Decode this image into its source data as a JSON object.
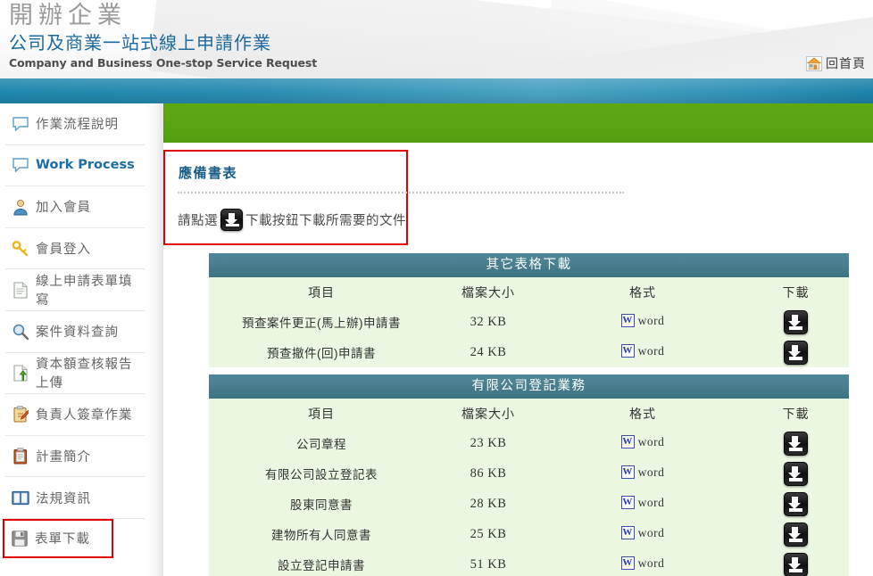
{
  "header": {
    "title_zh_large": "開辦企業",
    "title_zh_sub": "公司及商業一站式線上申請作業",
    "title_en": "Company and Business One-stop Service Request",
    "home_link_label": "回首頁",
    "home_icon": "house-icon"
  },
  "sidebar": {
    "items": [
      {
        "label": "作業流程說明",
        "icon": "speech-bubble-icon",
        "english": false,
        "selected": false
      },
      {
        "label": "Work Process",
        "icon": "speech-bubble-icon",
        "english": true,
        "selected": false
      },
      {
        "label": "加入會員",
        "icon": "user-add-icon",
        "english": false,
        "selected": false
      },
      {
        "label": "會員登入",
        "icon": "key-icon",
        "english": false,
        "selected": false
      },
      {
        "label": "線上申請表單填寫",
        "icon": "document-icon",
        "english": false,
        "selected": false
      },
      {
        "label": "案件資料查詢",
        "icon": "magnifier-icon",
        "english": false,
        "selected": false
      },
      {
        "label": "資本額查核報告上傳",
        "icon": "upload-document-icon",
        "english": false,
        "selected": false
      },
      {
        "label": "負責人簽章作業",
        "icon": "clipboard-pencil-icon",
        "english": false,
        "selected": false
      },
      {
        "label": "計畫簡介",
        "icon": "clipboard-icon",
        "english": false,
        "selected": false
      },
      {
        "label": "法規資訊",
        "icon": "book-icon",
        "english": false,
        "selected": false
      },
      {
        "label": "表單下載",
        "icon": "floppy-disk-icon",
        "english": false,
        "selected": true
      }
    ]
  },
  "notice": {
    "title": "應備書表",
    "text_before_icon": "請點選",
    "download_icon": "download-icon",
    "text_after_icon": "下載按鈕下載所需要的文件"
  },
  "tables": [
    {
      "section_title": "其它表格下載",
      "columns": [
        "項目",
        "檔案大小",
        "格式",
        "下載"
      ],
      "rows": [
        {
          "item": "預查案件更正(馬上辦)申請書",
          "size": "32 KB",
          "format": "word",
          "format_icon": "word-icon",
          "download_icon": "download-icon"
        },
        {
          "item": "預查撤件(回)申請書",
          "size": "24 KB",
          "format": "word",
          "format_icon": "word-icon",
          "download_icon": "download-icon"
        }
      ]
    },
    {
      "section_title": "有限公司登記業務",
      "columns": [
        "項目",
        "檔案大小",
        "格式",
        "下載"
      ],
      "rows": [
        {
          "item": "公司章程",
          "size": "23 KB",
          "format": "word",
          "format_icon": "word-icon",
          "download_icon": "download-icon"
        },
        {
          "item": "有限公司設立登記表",
          "size": "86 KB",
          "format": "word",
          "format_icon": "word-icon",
          "download_icon": "download-icon"
        },
        {
          "item": "股東同意書",
          "size": "28 KB",
          "format": "word",
          "format_icon": "word-icon",
          "download_icon": "download-icon"
        },
        {
          "item": "建物所有人同意書",
          "size": "25 KB",
          "format": "word",
          "format_icon": "word-icon",
          "download_icon": "download-icon"
        },
        {
          "item": "設立登記申請書",
          "size": "51 KB",
          "format": "word",
          "format_icon": "word-icon",
          "download_icon": "download-icon"
        }
      ]
    }
  ],
  "colors": {
    "brand_blue": "#1e6a9e",
    "band_blue": "#2a8cb2",
    "band_green": "#5aa513",
    "table_header": "#48808f",
    "row_green": "#ecf7e1",
    "highlight_red": "#e00000",
    "word_icon_blue": "#2b3fa5"
  }
}
